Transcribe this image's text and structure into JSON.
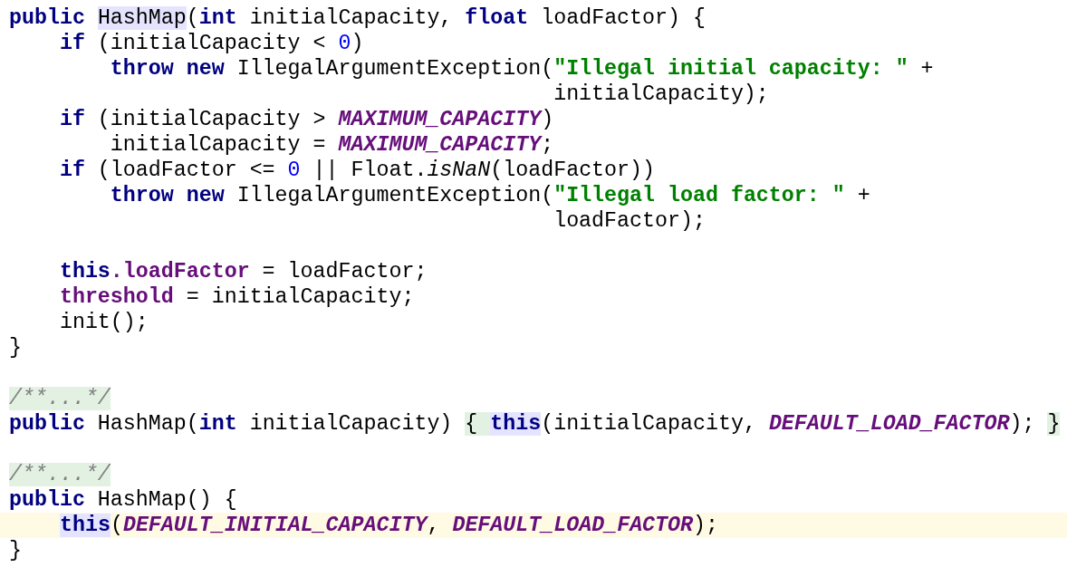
{
  "editor": {
    "lines": [
      {
        "current": false,
        "tokens": [
          {
            "kind": "kw",
            "text": "public "
          },
          {
            "kind": "usage",
            "text": "HashMap"
          },
          {
            "kind": "plain",
            "text": "("
          },
          {
            "kind": "kw",
            "text": "int"
          },
          {
            "kind": "plain",
            "text": " initialCapacity, "
          },
          {
            "kind": "kw",
            "text": "float"
          },
          {
            "kind": "plain",
            "text": " loadFactor) {"
          }
        ]
      },
      {
        "current": false,
        "tokens": [
          {
            "kind": "kw",
            "text": "    if"
          },
          {
            "kind": "plain",
            "text": " (initialCapacity < "
          },
          {
            "kind": "num",
            "text": "0"
          },
          {
            "kind": "plain",
            "text": ")"
          }
        ]
      },
      {
        "current": false,
        "tokens": [
          {
            "kind": "kw",
            "text": "        throw new"
          },
          {
            "kind": "plain",
            "text": " IllegalArgumentException("
          },
          {
            "kind": "str",
            "text": "\"Illegal initial capacity: \""
          },
          {
            "kind": "plain",
            "text": " +"
          }
        ]
      },
      {
        "current": false,
        "tokens": [
          {
            "kind": "plain",
            "text": "                                           initialCapacity);"
          }
        ]
      },
      {
        "current": false,
        "tokens": [
          {
            "kind": "kw",
            "text": "    if"
          },
          {
            "kind": "plain",
            "text": " (initialCapacity > "
          },
          {
            "kind": "const",
            "text": "MAXIMUM_CAPACITY"
          },
          {
            "kind": "plain",
            "text": ")"
          }
        ]
      },
      {
        "current": false,
        "tokens": [
          {
            "kind": "plain",
            "text": "        initialCapacity = "
          },
          {
            "kind": "const",
            "text": "MAXIMUM_CAPACITY"
          },
          {
            "kind": "plain",
            "text": ";"
          }
        ]
      },
      {
        "current": false,
        "tokens": [
          {
            "kind": "kw",
            "text": "    if"
          },
          {
            "kind": "plain",
            "text": " (loadFactor <= "
          },
          {
            "kind": "num",
            "text": "0"
          },
          {
            "kind": "plain",
            "text": " || Float."
          },
          {
            "kind": "static",
            "text": "isNaN"
          },
          {
            "kind": "plain",
            "text": "(loadFactor))"
          }
        ]
      },
      {
        "current": false,
        "tokens": [
          {
            "kind": "kw",
            "text": "        throw new"
          },
          {
            "kind": "plain",
            "text": " IllegalArgumentException("
          },
          {
            "kind": "str",
            "text": "\"Illegal load factor: \""
          },
          {
            "kind": "plain",
            "text": " +"
          }
        ]
      },
      {
        "current": false,
        "tokens": [
          {
            "kind": "plain",
            "text": "                                           loadFactor);"
          }
        ]
      },
      {
        "current": false
      },
      {
        "current": false,
        "tokens": [
          {
            "kind": "kw",
            "text": "    this"
          },
          {
            "kind": "field",
            "text": ".loadFactor"
          },
          {
            "kind": "plain",
            "text": " = loadFactor;"
          }
        ]
      },
      {
        "current": false,
        "tokens": [
          {
            "kind": "field",
            "text": "    threshold"
          },
          {
            "kind": "plain",
            "text": " = initialCapacity;"
          }
        ]
      },
      {
        "current": false,
        "tokens": [
          {
            "kind": "plain",
            "text": "    init();"
          }
        ]
      },
      {
        "current": false,
        "tokens": [
          {
            "kind": "plain",
            "text": "}"
          }
        ]
      },
      {
        "current": false
      },
      {
        "current": false,
        "tokens": [
          {
            "kind": "fold",
            "text": "/**...*/"
          }
        ]
      },
      {
        "current": false,
        "tokens": [
          {
            "kind": "kw",
            "text": "public"
          },
          {
            "kind": "plain",
            "text": " HashMap("
          },
          {
            "kind": "kw",
            "text": "int"
          },
          {
            "kind": "plain",
            "text": " initialCapacity) "
          },
          {
            "kind": "foldbrace",
            "text": "{ "
          },
          {
            "kind": "usagekw",
            "text": "this"
          },
          {
            "kind": "plain",
            "text": "(initialCapacity, "
          },
          {
            "kind": "const",
            "text": "DEFAULT_LOAD_FACTOR"
          },
          {
            "kind": "plain",
            "text": "); "
          },
          {
            "kind": "foldbrace",
            "text": "}"
          }
        ]
      },
      {
        "current": false
      },
      {
        "current": false,
        "tokens": [
          {
            "kind": "fold",
            "text": "/**...*/"
          }
        ]
      },
      {
        "current": false,
        "tokens": [
          {
            "kind": "kw",
            "text": "public"
          },
          {
            "kind": "plain",
            "text": " HashMap() {"
          }
        ]
      },
      {
        "current": true,
        "tokens": [
          {
            "kind": "usagekw",
            "text": "this"
          },
          {
            "kind": "plain",
            "text": "("
          },
          {
            "kind": "const",
            "text": "DEFAULT_INITIAL_CAPACITY"
          },
          {
            "kind": "plain",
            "text": ", "
          },
          {
            "kind": "const",
            "text": "DEFAULT_LOAD_FACTOR"
          },
          {
            "kind": "plain",
            "text": ");"
          }
        ]
      },
      {
        "current": false,
        "tokens": [
          {
            "kind": "plain",
            "text": "}"
          }
        ]
      }
    ]
  }
}
